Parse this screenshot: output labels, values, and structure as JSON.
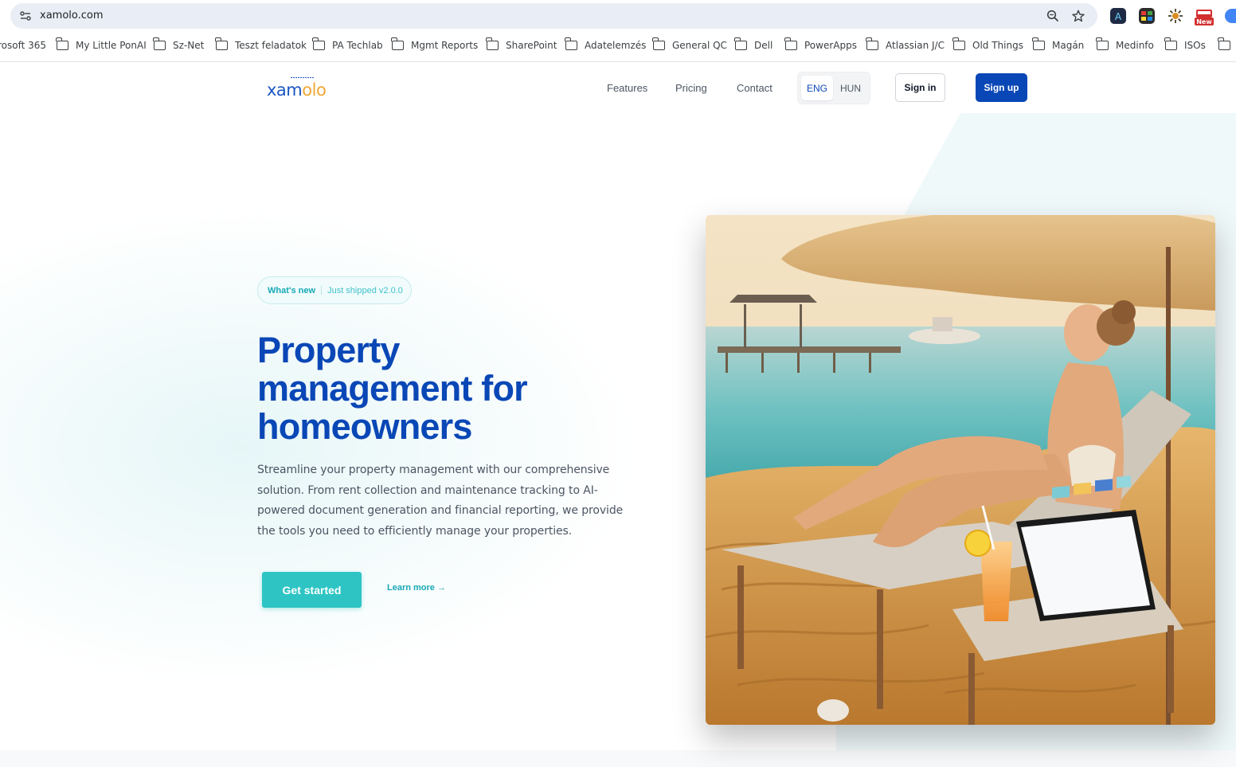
{
  "browser": {
    "url": "xamolo.com",
    "bookmarks": [
      "rosoft 365",
      "My Little PonAI",
      "Sz-Net",
      "Teszt feladatok",
      "PA Techlab",
      "Mgmt Reports",
      "SharePoint",
      "Adatelemzés",
      "General QC",
      "Dell",
      "PowerApps",
      "Atlassian J/C",
      "Old Things",
      "Magán",
      "Medinfo",
      "ISOs"
    ],
    "extension_badge": "New"
  },
  "site": {
    "logo_left": "xam",
    "logo_right": "olo",
    "nav": {
      "features": "Features",
      "pricing": "Pricing",
      "contact": "Contact"
    },
    "lang": {
      "active": "ENG",
      "other": "HUN"
    },
    "sign_in": "Sign in",
    "sign_up": "Sign up"
  },
  "hero": {
    "badge_label": "What's new",
    "badge_text": "Just shipped v2.0.0",
    "title": "Property management for homeowners",
    "subtitle": "Streamline your property management with our comprehensive solution. From rent collection and maintenance tracking to AI-powered document generation and financial reporting, we provide the tools you need to efficiently manage your properties.",
    "cta": "Get started",
    "learn_more": "Learn more →"
  },
  "colors": {
    "brand_blue": "#0a47b6",
    "accent_teal": "#2ec4c4",
    "logo_orange": "#f2a733"
  }
}
